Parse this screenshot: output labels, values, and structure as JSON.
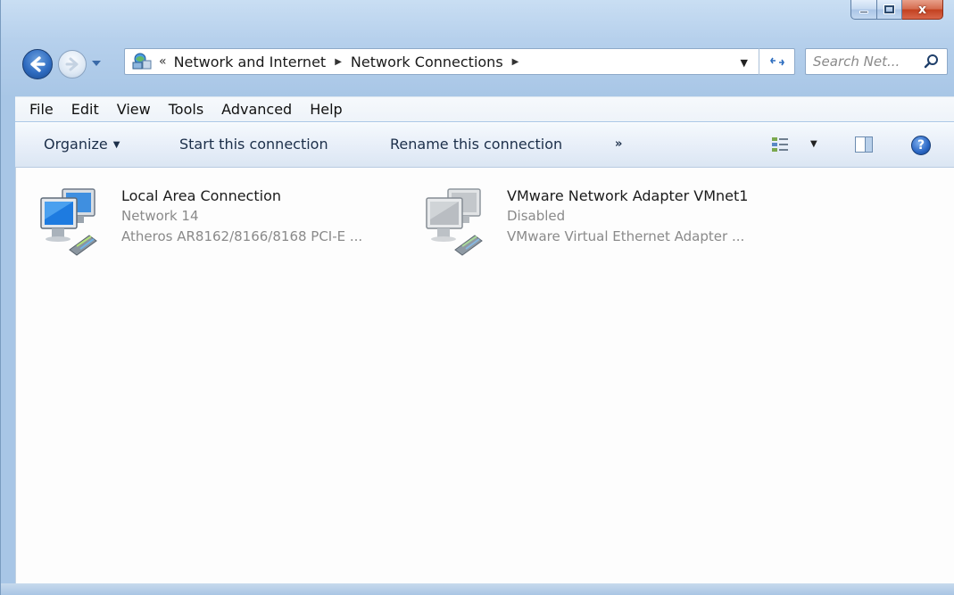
{
  "window": {
    "controls": {
      "minimize": "minimize",
      "maximize": "maximize",
      "close": "x"
    }
  },
  "address": {
    "overflow": "«",
    "crumbs": [
      "Network and Internet",
      "Network Connections"
    ],
    "search_placeholder": "Search Net..."
  },
  "menu": {
    "items": [
      "File",
      "Edit",
      "View",
      "Tools",
      "Advanced",
      "Help"
    ]
  },
  "commands": {
    "organize": "Organize",
    "start": "Start this connection",
    "rename": "Rename this connection",
    "more": "»",
    "help": "?"
  },
  "connections": [
    {
      "name": "Local Area Connection",
      "status": "Network 14",
      "device": "Atheros AR8162/8166/8168 PCI-E ...",
      "icon": "network-adapter-enabled-icon"
    },
    {
      "name": "VMware Network Adapter VMnet1",
      "status": "Disabled",
      "device": "VMware Virtual Ethernet Adapter ...",
      "icon": "network-adapter-disabled-icon"
    }
  ],
  "colors": {
    "chrome": "#b6d0ec",
    "command_text": "#1c2f4a",
    "secondary_text": "#8a8a8a",
    "close_button": "#c2401f"
  }
}
